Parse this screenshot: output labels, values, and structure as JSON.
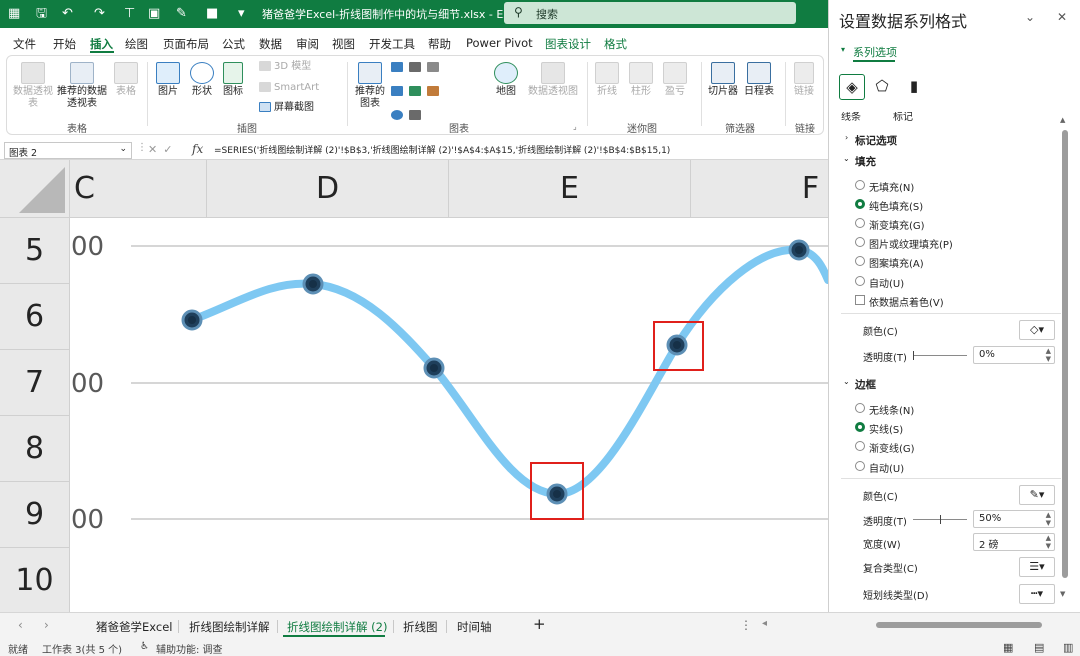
{
  "titlebar": {
    "doc_title": "猪爸爸学Excel-折线图制作中的坑与细节.xlsx  -  Ex...",
    "search_placeholder": "搜索",
    "icons": [
      "excel-logo-icon",
      "save-icon",
      "undo-icon",
      "redo-icon",
      "present-icon",
      "image-icon",
      "pen-icon",
      "color-icon",
      "customize-icon"
    ]
  },
  "menu": {
    "tabs": [
      "文件",
      "开始",
      "插入",
      "绘图",
      "页面布局",
      "公式",
      "数据",
      "审阅",
      "视图",
      "开发工具",
      "帮助",
      "Power Pivot",
      "图表设计",
      "格式"
    ],
    "active_tab": "插入"
  },
  "ribbon": {
    "groups": [
      {
        "label": "表格",
        "buttons": [
          "数据透视表",
          "推荐的数据透视表",
          "表格"
        ]
      },
      {
        "label": "插图",
        "buttons": [
          "图片",
          "形状",
          "图标",
          "3D 模型",
          "SmartArt",
          "屏幕截图"
        ]
      },
      {
        "label": "图表",
        "buttons": [
          "推荐的图表",
          "地图",
          "数据透视图"
        ]
      },
      {
        "label": "迷你图",
        "buttons": [
          "折线",
          "柱形",
          "盈亏"
        ]
      },
      {
        "label": "筛选器",
        "buttons": [
          "切片器",
          "日程表"
        ]
      },
      {
        "label": "链接",
        "buttons": [
          "链接"
        ]
      }
    ]
  },
  "formula_bar": {
    "name_box": "图表 2",
    "fx": "fx",
    "formula": "=SERIES('折线图绘制详解 (2)'!$B$3,'折线图绘制详解 (2)'!$A$4:$A$15,'折线图绘制详解 (2)'!$B$4:$B$15,1)"
  },
  "sheet": {
    "columns": [
      "C",
      "D",
      "E",
      "F"
    ],
    "rows": [
      "5",
      "6",
      "7",
      "8",
      "9",
      "10"
    ],
    "axis_labels": [
      "00",
      "00",
      "00"
    ]
  },
  "colors": {
    "excel_green": "#107c41",
    "series_line": "#7ec8f2",
    "marker_fill": "#1f3f5b",
    "highlight_box": "#e0201b"
  },
  "sheet_tabs": {
    "tabs": [
      "猪爸爸学Excel",
      "折线图绘制详解",
      "折线图绘制详解 (2)",
      "折线图",
      "时间轴"
    ],
    "active": "折线图绘制详解 (2)",
    "add": "+"
  },
  "status": {
    "ready": "就绪",
    "sheet_count": "工作表 3(共 5 个)",
    "accessibility": "辅助功能: 调查"
  },
  "pane": {
    "title": "设置数据系列格式",
    "subtitle": "系列选项",
    "partial_tabs": [
      "线条",
      "标记"
    ],
    "marker_options": "标记选项",
    "fill_header": "填充",
    "fill_options": [
      "无填充(N)",
      "纯色填充(S)",
      "渐变填充(G)",
      "图片或纹理填充(P)",
      "图案填充(A)",
      "自动(U)"
    ],
    "fill_selected": 1,
    "vary_colors": "依数据点着色(V)",
    "color_label": "颜色(C)",
    "transparency_label": "透明度(T)",
    "fill_transparency": "0%",
    "border_header": "边框",
    "border_options": [
      "无线条(N)",
      "实线(S)",
      "渐变线(G)",
      "自动(U)"
    ],
    "border_selected": 1,
    "border_color_label": "颜色(C)",
    "border_transparency_label": "透明度(T)",
    "border_transparency": "50%",
    "width_label": "宽度(W)",
    "width_value": "2 磅",
    "compound_label": "复合类型(C)",
    "dash_label": "短划线类型(D)"
  }
}
